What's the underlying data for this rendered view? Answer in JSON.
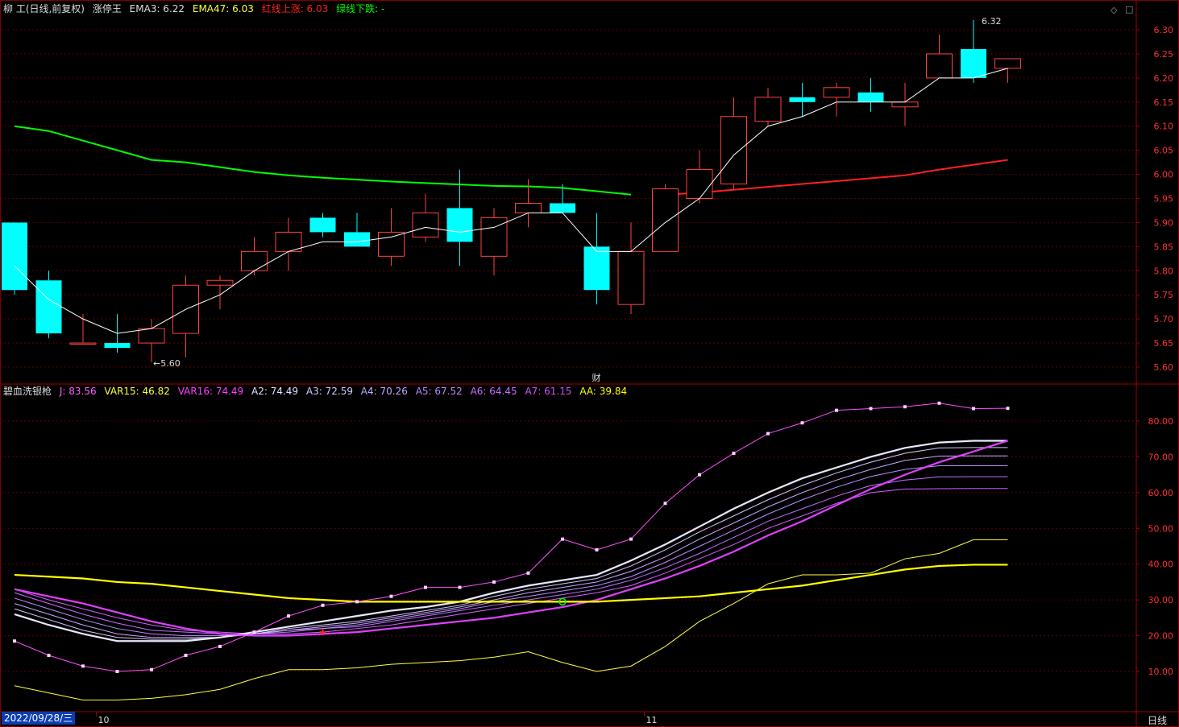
{
  "header": {
    "stock": "柳 工(日线,前复权)",
    "indicator": "涨停王",
    "ema3_label": "EMA3: 6.22",
    "ema47_label": "EMA47: 6.03",
    "red_up_label": "红线上涨: 6.03",
    "green_down_label": "绿线下跌: -"
  },
  "sub_header": {
    "name": "碧血洗银枪",
    "j": "J: 83.56",
    "var15": "VAR15: 46.82",
    "var16": "VAR16: 74.49",
    "a2": "A2: 74.49",
    "a3": "A3: 72.59",
    "a4": "A4: 70.26",
    "a5": "A5: 67.52",
    "a6": "A6: 64.45",
    "a7": "A7: 61.15",
    "aa": "AA: 39.84"
  },
  "footer": {
    "date": "2022/09/28/三",
    "period": "日线",
    "x_ticks": [
      {
        "i": 3,
        "label": "10"
      },
      {
        "i": 19,
        "label": "11"
      }
    ]
  },
  "controls": {
    "diamond": "◇",
    "square": "□"
  },
  "colors": {
    "up": "#ff4040",
    "down": "#00ffff",
    "ema3": "#ffffff",
    "ema47_down": "#00ff00",
    "ema47_up": "#ff2020",
    "grid": "#600000",
    "axis_text": "#ff3030",
    "j": "#ff60ff",
    "var15": "#ffff40",
    "aa": "#ffff00"
  },
  "chart_data": [
    {
      "type": "candlestick",
      "title": "柳 工(日线,前复权)",
      "yticks": [
        5.6,
        5.65,
        5.7,
        5.75,
        5.8,
        5.85,
        5.9,
        5.95,
        6.0,
        6.05,
        6.1,
        6.15,
        6.2,
        6.25,
        6.3
      ],
      "ylim": [
        5.58,
        6.34
      ],
      "high_marker": "6.32",
      "low_marker": "5.60",
      "event_marker": {
        "i": 17,
        "label": "财"
      },
      "candles": [
        {
          "o": 5.9,
          "h": 5.9,
          "l": 5.75,
          "c": 5.76
        },
        {
          "o": 5.78,
          "h": 5.8,
          "l": 5.66,
          "c": 5.67
        },
        {
          "o": 5.65,
          "h": 5.71,
          "l": 5.65,
          "c": 5.65
        },
        {
          "o": 5.65,
          "h": 5.71,
          "l": 5.63,
          "c": 5.64
        },
        {
          "o": 5.65,
          "h": 5.7,
          "l": 5.61,
          "c": 5.68
        },
        {
          "o": 5.67,
          "h": 5.79,
          "l": 5.62,
          "c": 5.77
        },
        {
          "o": 5.77,
          "h": 5.79,
          "l": 5.72,
          "c": 5.78
        },
        {
          "o": 5.8,
          "h": 5.87,
          "l": 5.79,
          "c": 5.84
        },
        {
          "o": 5.84,
          "h": 5.91,
          "l": 5.8,
          "c": 5.88
        },
        {
          "o": 5.91,
          "h": 5.92,
          "l": 5.87,
          "c": 5.88
        },
        {
          "o": 5.88,
          "h": 5.92,
          "l": 5.85,
          "c": 5.85
        },
        {
          "o": 5.83,
          "h": 5.93,
          "l": 5.81,
          "c": 5.88
        },
        {
          "o": 5.87,
          "h": 5.96,
          "l": 5.86,
          "c": 5.92
        },
        {
          "o": 5.93,
          "h": 6.01,
          "l": 5.81,
          "c": 5.86
        },
        {
          "o": 5.83,
          "h": 5.93,
          "l": 5.79,
          "c": 5.91
        },
        {
          "o": 5.92,
          "h": 5.99,
          "l": 5.89,
          "c": 5.94
        },
        {
          "o": 5.94,
          "h": 5.98,
          "l": 5.92,
          "c": 5.92
        },
        {
          "o": 5.85,
          "h": 5.92,
          "l": 5.73,
          "c": 5.76
        },
        {
          "o": 5.73,
          "h": 5.9,
          "l": 5.71,
          "c": 5.84
        },
        {
          "o": 5.84,
          "h": 5.98,
          "l": 5.84,
          "c": 5.97
        },
        {
          "o": 5.95,
          "h": 6.05,
          "l": 5.94,
          "c": 6.01
        },
        {
          "o": 5.98,
          "h": 6.16,
          "l": 5.97,
          "c": 6.12
        },
        {
          "o": 6.11,
          "h": 6.18,
          "l": 6.1,
          "c": 6.16
        },
        {
          "o": 6.16,
          "h": 6.19,
          "l": 6.12,
          "c": 6.15
        },
        {
          "o": 6.16,
          "h": 6.19,
          "l": 6.12,
          "c": 6.18
        },
        {
          "o": 6.17,
          "h": 6.2,
          "l": 6.13,
          "c": 6.15
        },
        {
          "o": 6.14,
          "h": 6.19,
          "l": 6.1,
          "c": 6.15
        },
        {
          "o": 6.2,
          "h": 6.29,
          "l": 6.2,
          "c": 6.25
        },
        {
          "o": 6.26,
          "h": 6.32,
          "l": 6.19,
          "c": 6.2
        },
        {
          "o": 6.22,
          "h": 6.24,
          "l": 6.19,
          "c": 6.24
        }
      ],
      "ema3": [
        5.81,
        5.74,
        5.7,
        5.67,
        5.68,
        5.72,
        5.75,
        5.8,
        5.84,
        5.86,
        5.86,
        5.87,
        5.89,
        5.88,
        5.89,
        5.92,
        5.92,
        5.84,
        5.84,
        5.9,
        5.95,
        6.04,
        6.1,
        6.12,
        6.15,
        6.15,
        6.15,
        6.2,
        6.2,
        6.22
      ],
      "ema47": [
        6.1,
        6.09,
        6.07,
        6.05,
        6.03,
        6.025,
        6.015,
        6.005,
        5.998,
        5.993,
        5.989,
        5.985,
        5.982,
        5.979,
        5.976,
        5.975,
        5.972,
        5.965,
        5.958,
        5.958,
        5.962,
        5.968,
        5.974,
        5.98,
        5.986,
        5.992,
        5.998,
        6.01,
        6.02,
        6.03
      ],
      "ema47_up_from_index": 19
    },
    {
      "type": "line",
      "title": "碧血洗银枪",
      "yticks": [
        10,
        20,
        30,
        40,
        50,
        60,
        70,
        80
      ],
      "ylim": [
        0,
        90
      ],
      "series": [
        {
          "name": "J",
          "values": [
            18.5,
            14.5,
            11.5,
            10,
            10.5,
            14.5,
            17,
            21,
            25.5,
            28.5,
            29.5,
            31,
            33.5,
            33.5,
            35,
            37.5,
            47,
            44,
            47,
            57,
            65,
            71,
            76.5,
            79.5,
            83,
            83.5,
            84,
            85,
            83.5,
            83.56
          ]
        },
        {
          "name": "VAR15",
          "values": [
            6,
            4,
            2,
            2,
            2.5,
            3.5,
            5,
            8,
            10.5,
            10.5,
            11,
            12,
            12.5,
            13,
            14,
            15.5,
            12.5,
            10,
            11.5,
            17,
            24,
            29,
            34.5,
            37,
            37,
            37.5,
            41.5,
            43,
            46.82,
            46.82
          ]
        },
        {
          "name": "VAR16",
          "values": [
            33,
            31,
            29,
            26.5,
            24,
            22,
            20.5,
            20,
            20,
            20.5,
            21,
            22,
            23,
            24,
            25,
            26.5,
            28,
            30,
            33,
            36,
            39.5,
            43.5,
            48,
            52,
            56.5,
            61,
            65,
            68.5,
            71.5,
            74.49
          ]
        },
        {
          "name": "A2",
          "values": [
            26,
            23,
            20.5,
            18.5,
            18.5,
            18.5,
            19.5,
            21,
            22.5,
            24,
            25.5,
            27,
            28,
            29.5,
            32,
            34,
            35.5,
            37,
            41,
            45.5,
            50.5,
            55.5,
            60,
            64,
            67,
            70,
            72.5,
            74,
            74.49,
            74.49
          ]
        },
        {
          "name": "A3",
          "values": [
            27.5,
            24.5,
            21.5,
            19.5,
            19,
            19,
            19.5,
            20.5,
            22,
            23,
            24,
            25.5,
            27,
            28.5,
            31,
            33,
            34.5,
            36,
            39.5,
            44,
            49,
            53.5,
            58,
            62,
            65.5,
            68.5,
            71,
            72.5,
            72.59,
            72.59
          ]
        },
        {
          "name": "A4",
          "values": [
            29,
            26,
            23,
            20.5,
            19.5,
            19.5,
            19.5,
            20.5,
            21.5,
            22.5,
            23.5,
            25,
            26.5,
            28,
            30,
            32,
            33.5,
            35,
            38,
            42,
            47,
            51.5,
            56,
            60,
            63.5,
            66.5,
            69,
            70.2,
            70.26,
            70.26
          ]
        },
        {
          "name": "A5",
          "values": [
            30.5,
            27.5,
            24.5,
            22,
            20.5,
            20,
            20,
            20.5,
            21.5,
            22,
            23,
            24.5,
            26,
            27.5,
            29.5,
            31,
            32.5,
            34,
            36.5,
            40.5,
            45,
            49.5,
            54,
            58,
            61.5,
            64.5,
            66.5,
            67.5,
            67.52,
            67.52
          ]
        },
        {
          "name": "A6",
          "values": [
            32,
            29,
            26,
            23.5,
            21.5,
            21,
            20.5,
            20.5,
            21,
            22,
            22.5,
            24,
            25.5,
            27,
            28.5,
            30,
            31.5,
            33,
            35.5,
            39,
            43,
            47.5,
            52,
            55.5,
            59,
            62,
            63.5,
            64.4,
            64.45,
            64.45
          ]
        },
        {
          "name": "A7",
          "values": [
            33,
            30,
            27.5,
            25,
            23,
            21.5,
            21,
            20.5,
            20.5,
            21,
            22,
            23,
            24.5,
            26,
            27.5,
            29,
            30.5,
            32,
            34,
            37.5,
            41.5,
            45.5,
            50,
            53.5,
            57,
            60,
            61,
            61.1,
            61.15,
            61.15
          ]
        },
        {
          "name": "AA",
          "values": [
            37,
            36.5,
            36,
            35,
            34.5,
            33.5,
            32.5,
            31.5,
            30.5,
            30,
            29.5,
            29.5,
            29.5,
            29.5,
            29.5,
            29.5,
            29.5,
            29.5,
            30,
            30.5,
            31,
            32,
            33,
            34,
            35.5,
            37,
            38.5,
            39.5,
            39.84,
            39.84
          ]
        }
      ],
      "markers": [
        {
          "i": 9,
          "series": "A7",
          "shape": "cross",
          "color": "#ff2020"
        },
        {
          "i": 16,
          "series": "AA",
          "shape": "circle",
          "color": "#00ff00"
        }
      ]
    }
  ]
}
